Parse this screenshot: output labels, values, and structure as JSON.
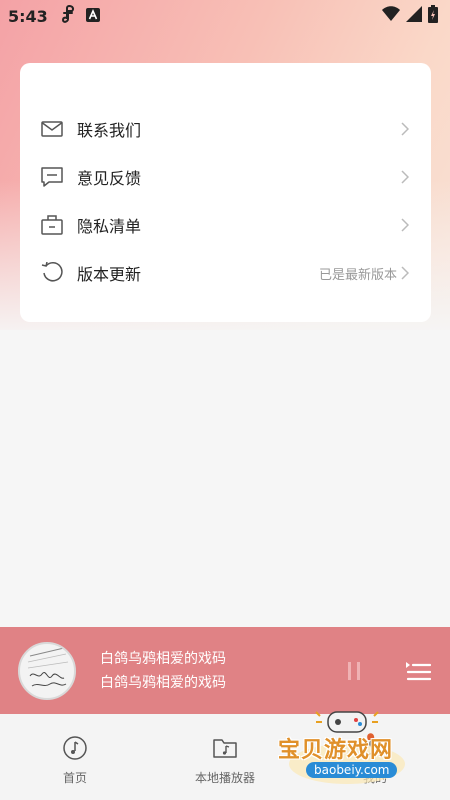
{
  "status_bar": {
    "time": "5:43",
    "app_icons": [
      "music-note-icon",
      "a-box-icon"
    ],
    "system_icons": [
      "wifi-icon",
      "signal-icon",
      "battery-icon"
    ]
  },
  "settings": {
    "items": [
      {
        "label": "联系我们",
        "icon": "mail-icon",
        "value": ""
      },
      {
        "label": "意见反馈",
        "icon": "feedback-icon",
        "value": ""
      },
      {
        "label": "隐私清单",
        "icon": "briefcase-icon",
        "value": ""
      },
      {
        "label": "版本更新",
        "icon": "refresh-icon",
        "value": "已是最新版本"
      }
    ]
  },
  "player": {
    "title": "白鸽乌鸦相爱的戏码",
    "artist": "白鸽乌鸦相爱的戏码",
    "state": "paused"
  },
  "bottom_nav": {
    "items": [
      {
        "label": "首页",
        "icon": "music-circle-icon"
      },
      {
        "label": "本地播放器",
        "icon": "music-folder-icon"
      },
      {
        "label": "我的",
        "icon": "profile-icon"
      }
    ]
  },
  "watermark": {
    "text": "宝贝游戏网",
    "url": "baobeiy.com"
  },
  "colors": {
    "accent": "#e08285",
    "card_bg": "#ffffff",
    "page_bg": "#f6f6f6",
    "header_gradient_start": "#f4a2a6",
    "header_gradient_end": "#f8e2d6"
  }
}
